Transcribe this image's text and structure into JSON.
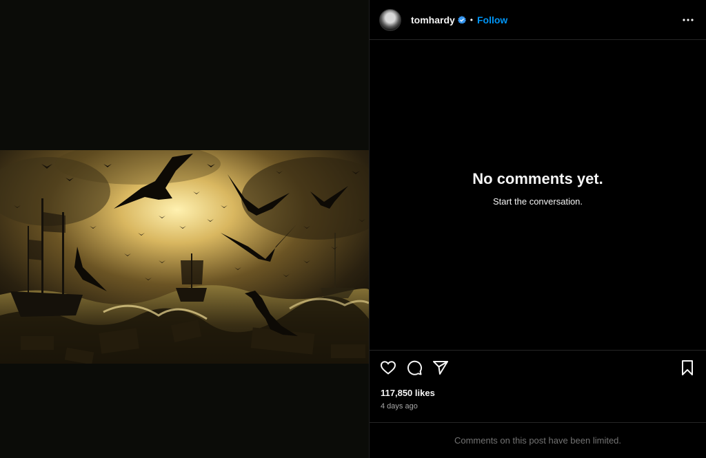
{
  "post": {
    "image_icon": "ships-storm-ravens-painting"
  },
  "header": {
    "username": "tomhardy",
    "separator": "•",
    "follow_label": "Follow",
    "verified_icon": "verified-badge-icon",
    "more_icon": "more-horizontal-icon"
  },
  "comments": {
    "empty_title": "No comments yet.",
    "empty_subtitle": "Start the conversation."
  },
  "actions": {
    "like_icon": "heart-icon",
    "comment_icon": "comment-icon",
    "share_icon": "send-icon",
    "save_icon": "bookmark-icon",
    "likes": "117,850 likes",
    "timestamp": "4 days ago"
  },
  "footer": {
    "limited_text": "Comments on this post have been limited."
  },
  "colors": {
    "accent": "#0095f6",
    "background": "#000000",
    "muted": "#a8a8a8",
    "border": "#262626"
  }
}
